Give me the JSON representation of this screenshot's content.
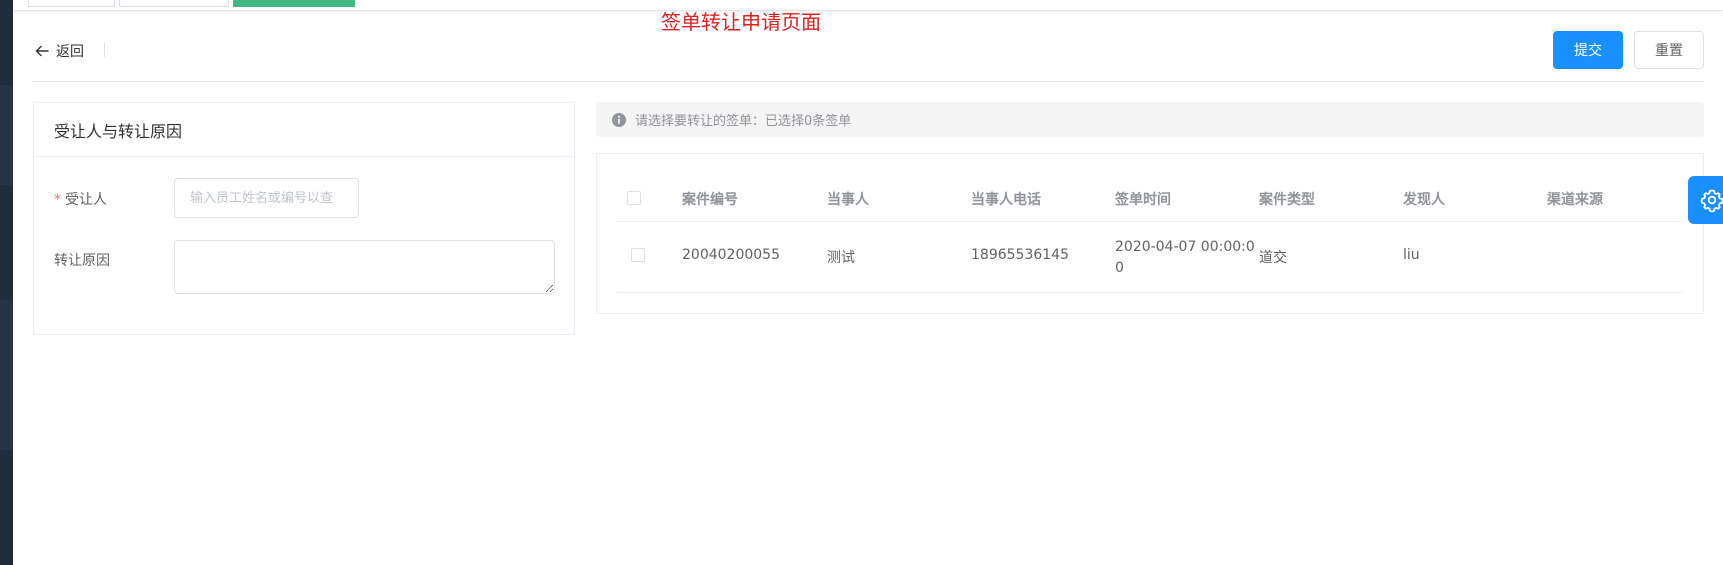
{
  "caption": "签单转让申请页面",
  "header": {
    "back_label": "返回",
    "submit_label": "提交",
    "reset_label": "重置"
  },
  "left_card": {
    "title": "受让人与转让原因",
    "assignee_label": "受让人",
    "assignee_placeholder": "输入员工姓名或编号以查",
    "reason_label": "转让原因"
  },
  "alert": {
    "text": "请选择要转让的签单：已选择0条签单"
  },
  "table": {
    "headers": [
      "案件编号",
      "当事人",
      "当事人电话",
      "签单时间",
      "案件类型",
      "发现人",
      "渠道来源"
    ],
    "rows": [
      {
        "case_no": "20040200055",
        "party": "测试",
        "phone": "18965536145",
        "time_line1": "2020-04-07 00:00:0",
        "time_line2": "0",
        "case_type": "道交",
        "finder": "liu",
        "channel": ""
      }
    ]
  },
  "colors": {
    "primary": "#1890ff",
    "caption": "#e02020",
    "tag_active": "#42b983"
  },
  "icons": [
    "arrow-left-icon",
    "info-icon",
    "gear-icon"
  ]
}
